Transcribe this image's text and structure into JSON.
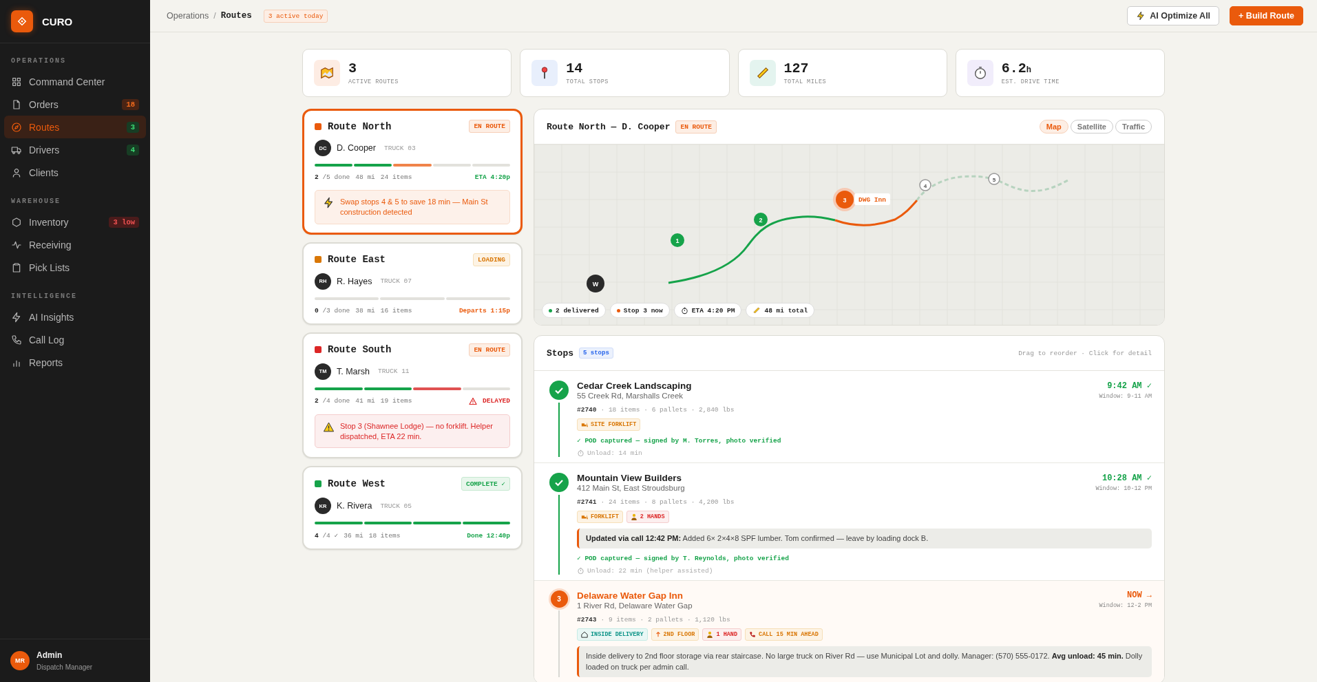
{
  "brand": {
    "name": "CURO"
  },
  "sidebar": {
    "sections": [
      {
        "title": "OPERATIONS",
        "items": [
          {
            "label": "Command Center",
            "selected": false
          },
          {
            "label": "Orders",
            "selected": false,
            "badge": {
              "text": "18",
              "kind": "warning"
            }
          },
          {
            "label": "Routes",
            "selected": true,
            "badge": {
              "text": "3",
              "kind": "ok"
            }
          },
          {
            "label": "Drivers",
            "selected": false,
            "badge": {
              "text": "4",
              "kind": "ok"
            }
          },
          {
            "label": "Clients",
            "selected": false
          }
        ]
      },
      {
        "title": "WAREHOUSE",
        "items": [
          {
            "label": "Inventory",
            "selected": false,
            "badge": {
              "text": "3 low",
              "kind": "alert"
            }
          },
          {
            "label": "Receiving",
            "selected": false
          },
          {
            "label": "Pick Lists",
            "selected": false
          }
        ]
      },
      {
        "title": "INTELLIGENCE",
        "items": [
          {
            "label": "AI Insights",
            "selected": false
          },
          {
            "label": "Call Log",
            "selected": false
          },
          {
            "label": "Reports",
            "selected": false
          }
        ]
      }
    ]
  },
  "user": {
    "initials": "MR",
    "name": "Admin",
    "role": "Dispatch Manager"
  },
  "topbar": {
    "breadcrumb": [
      "Operations",
      "Routes"
    ],
    "separator": "/",
    "badge": "3 active today",
    "buttons": [
      {
        "label": "AI Optimize All",
        "kind": "ai"
      },
      {
        "label": "+ Build Route",
        "kind": "primary"
      }
    ]
  },
  "stats": [
    {
      "value": "3",
      "label": "ACTIVE ROUTES",
      "color": "#fdece3"
    },
    {
      "value": "14",
      "label": "TOTAL STOPS",
      "color": "#e8effc"
    },
    {
      "value": "127",
      "label": "TOTAL MILES",
      "color": "#e4f4ef"
    },
    {
      "value": "6.2",
      "unit": "h",
      "label": "EST. DRIVE TIME",
      "color": "#f1edfb"
    }
  ],
  "routes": [
    {
      "name": "Route North",
      "color": "#ea5a0c",
      "selected": true,
      "status": {
        "text": "EN ROUTE",
        "kind": "en_route"
      },
      "driver": {
        "initials": "DC",
        "name": "D. Cooper",
        "truck": "TRUCK 03"
      },
      "segments": [
        {
          "kind": "done"
        },
        {
          "kind": "done"
        },
        {
          "kind": "active"
        },
        {
          "kind": "pending"
        },
        {
          "kind": "pending"
        }
      ],
      "done": "2",
      "total": "/5 done",
      "miles": "48 mi",
      "items": "24 items",
      "eta": {
        "text": "ETA 4:20p",
        "kind": "ok"
      },
      "alert": {
        "kind": "tip",
        "text": "Swap stops 4 & 5 to save 18 min — Main St construction detected"
      }
    },
    {
      "name": "Route East",
      "color": "#d97706",
      "selected": false,
      "status": {
        "text": "LOADING",
        "kind": "loading"
      },
      "driver": {
        "initials": "RH",
        "name": "R. Hayes",
        "truck": "TRUCK 07"
      },
      "segments": [
        {
          "kind": "pending"
        },
        {
          "kind": "pending"
        },
        {
          "kind": "pending"
        }
      ],
      "done": "0",
      "total": "/3 done",
      "miles": "38 mi",
      "items": "16 items",
      "eta": {
        "text": "Departs 1:15p",
        "kind": "waiting"
      }
    },
    {
      "name": "Route South",
      "color": "#dc2626",
      "selected": false,
      "status": {
        "text": "EN ROUTE",
        "kind": "en_route"
      },
      "driver": {
        "initials": "TM",
        "name": "T. Marsh",
        "truck": "TRUCK 11"
      },
      "segments": [
        {
          "kind": "done"
        },
        {
          "kind": "done"
        },
        {
          "kind": "delayed"
        },
        {
          "kind": "pending"
        }
      ],
      "done": "2",
      "total": "/4 done",
      "miles": "41 mi",
      "items": "19 items",
      "eta": {
        "text": "DELAYED",
        "kind": "delayed"
      },
      "alert": {
        "kind": "error",
        "text": "Stop 3 (Shawnee Lodge) — no forklift. Helper dispatched, ETA 22 min."
      }
    },
    {
      "name": "Route West",
      "color": "#16a34a",
      "selected": false,
      "status": {
        "text": "COMPLETE ✓",
        "kind": "complete"
      },
      "driver": {
        "initials": "KR",
        "name": "K. Rivera",
        "truck": "TRUCK 05"
      },
      "segments": [
        {
          "kind": "done"
        },
        {
          "kind": "done"
        },
        {
          "kind": "done"
        },
        {
          "kind": "done"
        }
      ],
      "done": "4",
      "total": "/4 ✓",
      "miles": "36 mi",
      "items": "18 items",
      "eta": {
        "text": "Done 12:40p",
        "kind": "ok"
      }
    }
  ],
  "map": {
    "title": "Route North — D. Cooper",
    "status": {
      "text": "EN ROUTE",
      "kind": "en_route"
    },
    "views": [
      {
        "label": "Map",
        "selected": true
      },
      {
        "label": "Satellite",
        "selected": false
      },
      {
        "label": "Traffic",
        "selected": false
      }
    ],
    "markers": [
      {
        "label": "W",
        "kind": "warehouse"
      },
      {
        "label": "1",
        "kind": "done"
      },
      {
        "label": "2",
        "kind": "done"
      },
      {
        "label": "3",
        "kind": "current",
        "tag": "DWG Inn"
      },
      {
        "label": "4",
        "kind": "pending"
      },
      {
        "label": "5",
        "kind": "pending"
      }
    ],
    "legend": [
      {
        "text": "2 delivered",
        "kind": "dot",
        "color": "#16a34a"
      },
      {
        "text": "Stop 3 now",
        "kind": "dot",
        "color": "#ea5a0c"
      },
      {
        "text": "ETA 4:20 PM",
        "kind": "timer"
      },
      {
        "text": "48 mi total",
        "kind": "ruler"
      }
    ]
  },
  "stops": {
    "title": "Stops",
    "count": "5 stops",
    "hint": "Drag to reorder · Click for detail",
    "items": [
      {
        "kind": "done",
        "name": "Cedar Creek Landscaping",
        "address": "55 Creek Rd, Marshalls Creek",
        "time": "9:42 AM ✓",
        "window": "Window: 9-11 AM",
        "order": "#2740",
        "meta": "· 18 items · 6 pallets · 2,840 lbs",
        "tags": [
          {
            "text": "SITE FORKLIFT",
            "kind": "forklift"
          }
        ],
        "pod": "✓ POD captured — signed by M. Torres, photo verified",
        "unload": "Unload: 14 min"
      },
      {
        "kind": "done",
        "name": "Mountain View Builders",
        "address": "412 Main St, East Stroudsburg",
        "time": "10:28 AM ✓",
        "window": "Window: 10-12 PM",
        "order": "#2741",
        "meta": "· 24 items · 8 pallets · 4,200 lbs",
        "tags": [
          {
            "text": "FORKLIFT",
            "kind": "forklift"
          },
          {
            "text": "2 HANDS",
            "kind": "crew"
          }
        ],
        "note": "**Updated via call 12:42 PM:** Added 6× 2×4×8 SPF lumber. Tom confirmed — leave by loading dock B.",
        "pod": "✓ POD captured — signed by T. Reynolds, photo verified",
        "unload": "Unload: 22 min (helper assisted)"
      },
      {
        "kind": "current",
        "marker": "3",
        "name": "Delaware Water Gap Inn",
        "address": "1 River Rd, Delaware Water Gap",
        "time": "NOW →",
        "window": "Window: 12-2 PM",
        "order": "#2743",
        "meta": "· 9 items · 2 pallets · 1,120 lbs",
        "tags": [
          {
            "text": "INSIDE DELIVERY",
            "kind": "access"
          },
          {
            "text": "2ND FLOOR",
            "kind": "stairs"
          },
          {
            "text": "1 HAND",
            "kind": "crew"
          },
          {
            "text": "CALL 15 MIN AHEAD",
            "kind": "call"
          }
        ],
        "note": "Inside delivery to 2nd floor storage via rear staircase. No large truck on River Rd — use Municipal Lot and dolly. Manager: (570) 555-0172. **Avg unload: 45 min.** Dolly loaded on truck per admin call."
      }
    ]
  }
}
